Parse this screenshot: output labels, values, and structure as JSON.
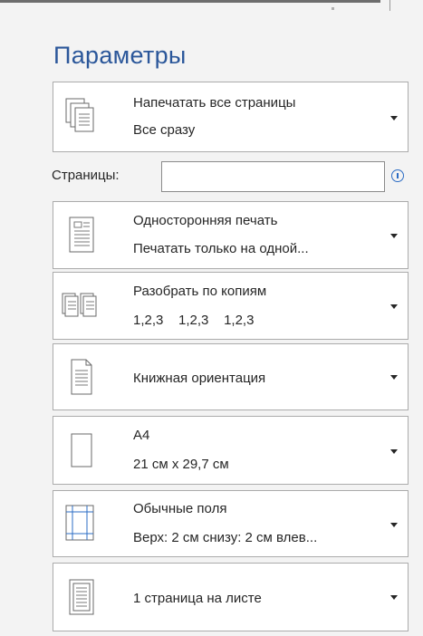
{
  "section_title": "Параметры",
  "pages_label": "Страницы:",
  "pages_value": "",
  "dropdowns": [
    {
      "name": "print-range",
      "icon": "pages-stack-icon",
      "line1": "Напечатать все страницы",
      "line2": "Все сразу"
    },
    {
      "name": "sides",
      "icon": "one-sided-page-icon",
      "line1": "Односторонняя печать",
      "line2": "Печатать только на одной..."
    },
    {
      "name": "collation",
      "icon": "collated-pages-icon",
      "line1": "Разобрать по копиям",
      "line2": "1,2,3    1,2,3    1,2,3"
    },
    {
      "name": "orientation",
      "icon": "portrait-page-icon",
      "line1": "Книжная ориентация",
      "line2": ""
    },
    {
      "name": "paper-size",
      "icon": "paper-size-icon",
      "line1": "А4",
      "line2": "21 см x 29,7 см"
    },
    {
      "name": "margins",
      "icon": "margins-icon",
      "line1": "Обычные поля",
      "line2": "Верх: 2 см снизу: 2 см влев..."
    },
    {
      "name": "pages-per-sheet",
      "icon": "pages-per-sheet-icon",
      "line1": "1 страница на листе",
      "line2": ""
    }
  ],
  "colors": {
    "accent": "#2b579a",
    "info": "#2b6cc4",
    "panel_bg": "#f3f3f3",
    "border": "#ababab"
  }
}
